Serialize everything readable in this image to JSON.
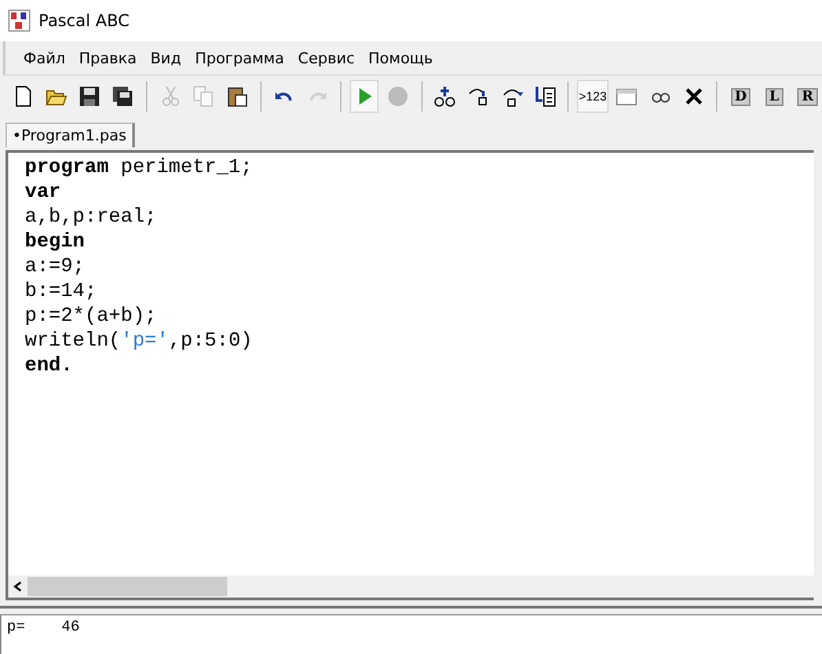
{
  "window": {
    "title": "Pascal ABC"
  },
  "menu": [
    {
      "label": "Файл"
    },
    {
      "label": "Правка"
    },
    {
      "label": "Вид"
    },
    {
      "label": "Программа"
    },
    {
      "label": "Сервис"
    },
    {
      "label": "Помощь"
    }
  ],
  "toolbar": [
    {
      "kind": "new",
      "disabled": false,
      "pressed": false
    },
    {
      "kind": "open",
      "disabled": false,
      "pressed": false
    },
    {
      "kind": "save",
      "disabled": false,
      "pressed": false
    },
    {
      "kind": "saveall",
      "disabled": false,
      "pressed": false
    },
    {
      "kind": "sep"
    },
    {
      "kind": "cut",
      "disabled": true,
      "pressed": false
    },
    {
      "kind": "copy",
      "disabled": true,
      "pressed": false
    },
    {
      "kind": "paste",
      "disabled": false,
      "pressed": false
    },
    {
      "kind": "sep"
    },
    {
      "kind": "undo",
      "disabled": false,
      "pressed": false
    },
    {
      "kind": "redo",
      "disabled": true,
      "pressed": false
    },
    {
      "kind": "sep"
    },
    {
      "kind": "run",
      "disabled": false,
      "pressed": true
    },
    {
      "kind": "stop",
      "disabled": true,
      "pressed": false
    },
    {
      "kind": "sep"
    },
    {
      "kind": "watch",
      "disabled": false,
      "pressed": false
    },
    {
      "kind": "stepin",
      "disabled": false,
      "pressed": false
    },
    {
      "kind": "stepover",
      "disabled": false,
      "pressed": false
    },
    {
      "kind": "tocursor",
      "disabled": false,
      "pressed": false
    },
    {
      "kind": "sep"
    },
    {
      "kind": "text",
      "label": ">123",
      "disabled": false,
      "pressed": true
    },
    {
      "kind": "window",
      "disabled": false,
      "pressed": false
    },
    {
      "kind": "glasses",
      "disabled": false,
      "pressed": false
    },
    {
      "kind": "close",
      "disabled": false,
      "pressed": false
    },
    {
      "kind": "sep"
    },
    {
      "kind": "letter",
      "label": "D",
      "disabled": false,
      "pressed": false
    },
    {
      "kind": "letter",
      "label": "L",
      "disabled": false,
      "pressed": false
    },
    {
      "kind": "letter",
      "label": "R",
      "disabled": false,
      "pressed": false
    }
  ],
  "tabs": [
    {
      "label": "•Program1.pas",
      "selected": true
    }
  ],
  "code": [
    [
      {
        "kind": "keyword",
        "text": "program"
      },
      {
        "kind": "plain",
        "text": " perimetr_1;"
      }
    ],
    [
      {
        "kind": "keyword",
        "text": "var"
      }
    ],
    [
      {
        "kind": "plain",
        "text": "a,b,p:real;"
      }
    ],
    [
      {
        "kind": "keyword",
        "text": "begin"
      }
    ],
    [
      {
        "kind": "plain",
        "text": "a:=9;"
      }
    ],
    [
      {
        "kind": "plain",
        "text": "b:=14;"
      }
    ],
    [
      {
        "kind": "plain",
        "text": "p:=2*(a+b);"
      }
    ],
    [
      {
        "kind": "plain",
        "text": "writeln("
      },
      {
        "kind": "string",
        "text": "'p='"
      },
      {
        "kind": "plain",
        "text": ",p:5:0)"
      }
    ],
    [
      {
        "kind": "keyword",
        "text": "end."
      }
    ]
  ],
  "output": "p=    46"
}
